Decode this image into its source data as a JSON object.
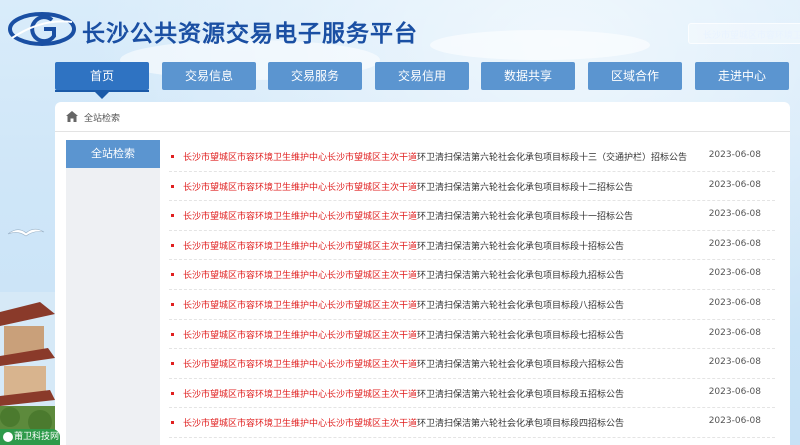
{
  "header": {
    "title": "长沙公共资源交易电子服务平台",
    "search_placeholder": "长沙市望城区市容环境卫生维护"
  },
  "nav": {
    "items": [
      {
        "label": "首页",
        "active": true
      },
      {
        "label": "交易信息"
      },
      {
        "label": "交易服务"
      },
      {
        "label": "交易信用"
      },
      {
        "label": "数据共享"
      },
      {
        "label": "区域合作"
      },
      {
        "label": "走进中心"
      }
    ]
  },
  "breadcrumb": {
    "label": "全站检索"
  },
  "sidebar": {
    "items": [
      {
        "label": "全站检索"
      }
    ]
  },
  "results": [
    {
      "highlight": "长沙市望城区市容环境卫生维护中心长沙市望城区主次干道",
      "rest": "环卫清扫保洁第六轮社会化承包项目标段十三（交通护栏）招标公告",
      "date": "2023-06-08"
    },
    {
      "highlight": "长沙市望城区市容环境卫生维护中心长沙市望城区主次干道",
      "rest": "环卫清扫保洁第六轮社会化承包项目标段十二招标公告",
      "date": "2023-06-08"
    },
    {
      "highlight": "长沙市望城区市容环境卫生维护中心长沙市望城区主次干道",
      "rest": "环卫清扫保洁第六轮社会化承包项目标段十一招标公告",
      "date": "2023-06-08"
    },
    {
      "highlight": "长沙市望城区市容环境卫生维护中心长沙市望城区主次干道",
      "rest": "环卫清扫保洁第六轮社会化承包项目标段十招标公告",
      "date": "2023-06-08"
    },
    {
      "highlight": "长沙市望城区市容环境卫生维护中心长沙市望城区主次干道",
      "rest": "环卫清扫保洁第六轮社会化承包项目标段九招标公告",
      "date": "2023-06-08"
    },
    {
      "highlight": "长沙市望城区市容环境卫生维护中心长沙市望城区主次干道",
      "rest": "环卫清扫保洁第六轮社会化承包项目标段八招标公告",
      "date": "2023-06-08"
    },
    {
      "highlight": "长沙市望城区市容环境卫生维护中心长沙市望城区主次干道",
      "rest": "环卫清扫保洁第六轮社会化承包项目标段七招标公告",
      "date": "2023-06-08"
    },
    {
      "highlight": "长沙市望城区市容环境卫生维护中心长沙市望城区主次干道",
      "rest": "环卫清扫保洁第六轮社会化承包项目标段六招标公告",
      "date": "2023-06-08"
    },
    {
      "highlight": "长沙市望城区市容环境卫生维护中心长沙市望城区主次干道",
      "rest": "环卫清扫保洁第六轮社会化承包项目标段五招标公告",
      "date": "2023-06-08"
    },
    {
      "highlight": "长沙市望城区市容环境卫生维护中心长沙市望城区主次干道",
      "rest": "环卫清扫保洁第六轮社会化承包项目标段四招标公告",
      "date": "2023-06-08"
    }
  ],
  "footer_badge": "莆卫科技网",
  "colors": {
    "nav_bg": "#5b95d0",
    "nav_active": "#2f73c2",
    "highlight_text": "#e02020",
    "title": "#1a4fa3"
  },
  "icons": [
    "logo-icon",
    "home-icon",
    "bullet-icon"
  ]
}
